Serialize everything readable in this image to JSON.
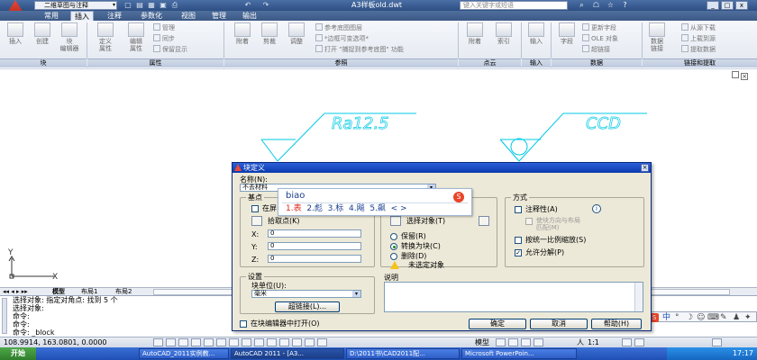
{
  "titlebar": {
    "workspace": "二维草图与注释",
    "doc_title": "A3样板old.dwt",
    "search_placeholder": "键入关键字或短语",
    "win": [
      "_",
      "□",
      "x"
    ]
  },
  "tabs": [
    {
      "label": "常用",
      "active": false
    },
    {
      "label": "插入",
      "active": true
    },
    {
      "label": "注释",
      "active": false
    },
    {
      "label": "参数化",
      "active": false
    },
    {
      "label": "视图",
      "active": false
    },
    {
      "label": "管理",
      "active": false
    },
    {
      "label": "输出",
      "active": false
    }
  ],
  "ribbon": {
    "big_buttons": [
      "插入",
      "创建",
      "块\n编辑器",
      "定义\n属性",
      "编辑\n属性",
      "附着",
      "剪裁",
      "调整",
      "附着",
      "索引",
      "输入",
      "字段",
      "数据\n链接"
    ],
    "small_block": [
      "管理",
      "同步",
      "保留显示"
    ],
    "small_ref": [
      "参考底图图层",
      "*边框可变选项*",
      "打开 \"捕捉到参考底图\" 功能"
    ],
    "small_data": [
      "更新字段",
      "OLE 对象",
      "超链接"
    ],
    "small_link": [
      "从源下载",
      "上载到源",
      "提取数据"
    ],
    "panels": [
      "块",
      "属性",
      "参照",
      "点云",
      "输入",
      "数据",
      "链接和提取"
    ]
  },
  "drawing": {
    "symbol1_text": "Ra12.5",
    "symbol2_text": "CCD",
    "axis_y": "Y",
    "axis_x": "X"
  },
  "layout_tabs": [
    "模型",
    "布局1",
    "布局2"
  ],
  "command": {
    "lines": [
      "选择对象: 指定对角点: 找到 5 个",
      "选择对象:",
      "命令:",
      "命令:",
      "命令: _block"
    ]
  },
  "status": {
    "coords": "108.9914, 163.0801, 0.0000",
    "model": "模型",
    "scale": "1:1",
    "annot": "人"
  },
  "taskbar": {
    "start": "开始",
    "tasks": [
      "AutoCAD_2011实例教...",
      "AutoCAD 2011 - [A3...",
      "D:\\2011书\\CAD2011配...",
      "Microsoft PowerPoin..."
    ],
    "clock": "17:17"
  },
  "dialog": {
    "title": "块定义",
    "name_label": "名称(N):",
    "name_value": "不去材料",
    "base_group": "基点",
    "onscreen1": "在屏",
    "pick_point": "拾取点(K)",
    "x_label": "X:",
    "x_value": "0",
    "y_label": "Y:",
    "y_value": "0",
    "z_label": "Z:",
    "z_value": "0",
    "select_objects": "选择对象(T)",
    "retain": "保留(R)",
    "convert": "转换为块(C)",
    "delete": "删除(D)",
    "no_objects": "未选定对象",
    "behavior_group": "方式",
    "annotative": "注释性(A)",
    "match_layout": "使块方向与布局\n匹配(M)",
    "uniform_scale": "按统一比例缩放(S)",
    "allow_explode": "允许分解(P)",
    "settings_group": "设置",
    "units_label": "块单位(U):",
    "units_value": "毫米",
    "hyperlink": "超链接(L)...",
    "desc_label": "说明",
    "open_editor": "在块编辑器中打开(O)",
    "ok": "确定",
    "cancel": "取消",
    "help": "帮助(H)"
  },
  "ime": {
    "input": "biao",
    "candidates": [
      "1.表",
      "2.彪",
      "3.标",
      "4.飚",
      "5.飙"
    ],
    "nav": "< >"
  },
  "tray": {
    "items": [
      "S",
      "中",
      "°",
      "☽",
      "☺",
      "⌨",
      "✎",
      "♟",
      "✦"
    ]
  }
}
